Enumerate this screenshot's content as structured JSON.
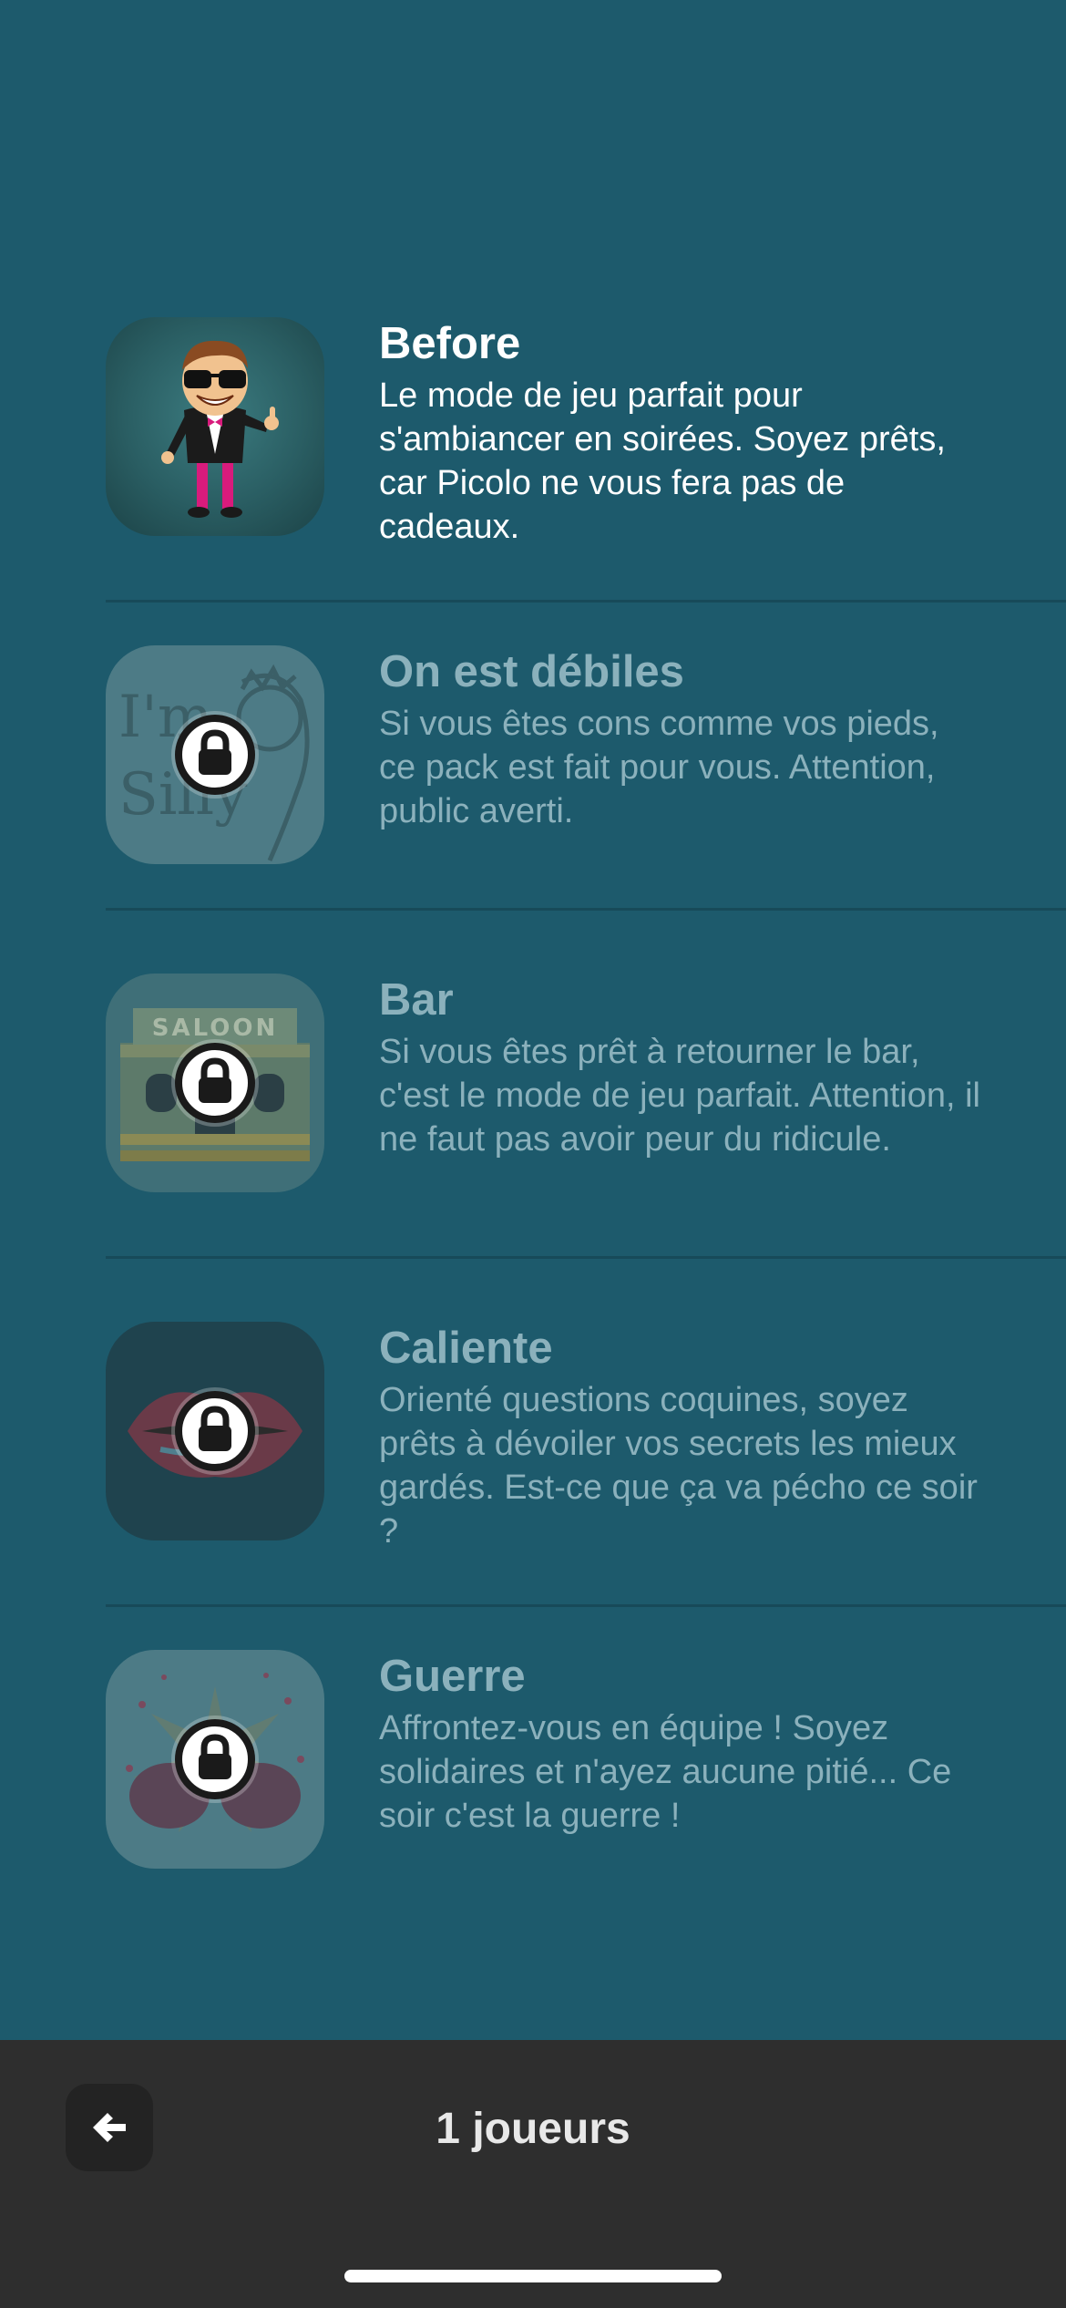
{
  "packs": [
    {
      "title": "Before",
      "description": "Le mode de jeu parfait pour s'ambiancer en soirées. Soyez prêts, car Picolo ne vous fera pas de cadeaux.",
      "locked": false,
      "icon": "dancing-man-sunglasses-icon"
    },
    {
      "title": "On est débiles",
      "description": "Si vous êtes cons comme vos pieds, ce pack est fait pour vous. Attention, public averti.",
      "locked": true,
      "icon": "im-silly-face-icon",
      "art_text": "I'm Silly"
    },
    {
      "title": "Bar",
      "description": "Si vous êtes prêt à retourner le bar, c'est le mode de jeu parfait. Attention, il ne faut pas avoir peur du ridicule.",
      "locked": true,
      "icon": "saloon-icon",
      "art_text": "SALOON"
    },
    {
      "title": "Caliente",
      "description": "Orienté questions coquines, soyez prêts à dévoiler vos secrets les mieux gardés. Est-ce que ça va pécho ce soir ?",
      "locked": true,
      "icon": "lips-icon"
    },
    {
      "title": "Guerre",
      "description": "Affrontez-vous en équipe ! Soyez solidaires et n'ayez aucune pitié... Ce soir c'est la guerre !",
      "locked": true,
      "icon": "boxing-gloves-icon"
    }
  ],
  "bottom_bar": {
    "players_label": "1 joueurs",
    "back_icon": "arrow-left-icon"
  },
  "colors": {
    "background": "#1d5a6c",
    "divider": "#174a59",
    "locked_text": "#8bb1bc",
    "bottom_bar": "#2e2e2e"
  }
}
